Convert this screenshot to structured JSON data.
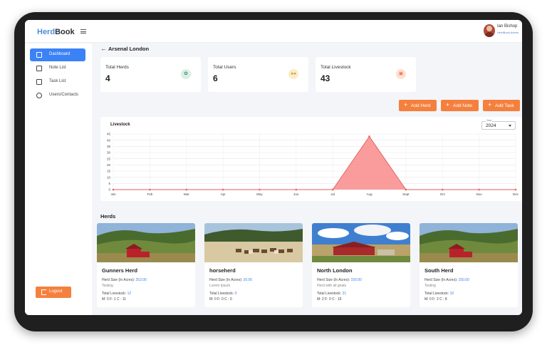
{
  "brand": {
    "part1": "Herd",
    "part2": "Book"
  },
  "user": {
    "name": "Ian Bishop",
    "role": "HerdBook Admin"
  },
  "sidebar": {
    "items": [
      {
        "label": "Dashboard",
        "icon": "grid-icon",
        "active": true
      },
      {
        "label": "Note List",
        "icon": "note-icon",
        "active": false
      },
      {
        "label": "Task List",
        "icon": "checkbox-icon",
        "active": false
      },
      {
        "label": "Users/Contacts",
        "icon": "users-icon",
        "active": false
      }
    ],
    "logout_label": "Logout"
  },
  "page": {
    "title": "Arsenal London"
  },
  "stats": [
    {
      "label": "Total Herds",
      "value": "4",
      "icon": "herd-icon",
      "color": "#d9efe6"
    },
    {
      "label": "Total Users",
      "value": "6",
      "icon": "users-icon",
      "color": "#fbeccb"
    },
    {
      "label": "Total Livestock",
      "value": "43",
      "icon": "livestock-icon",
      "color": "#fde0d4"
    }
  ],
  "actions": {
    "add_herd": "Add Herd",
    "add_note": "Add Note",
    "add_task": "Add Task"
  },
  "year_select": {
    "caption": "Year",
    "value": "2024"
  },
  "chart_data": {
    "type": "area",
    "title": "Livestock",
    "categories": [
      "Jan",
      "Feb",
      "Mar",
      "Apr",
      "May",
      "Jun",
      "Jul",
      "Aug",
      "Sept",
      "Oct",
      "Nov",
      "Dec"
    ],
    "values": [
      0,
      0,
      0,
      0,
      0,
      0,
      0,
      43,
      0,
      0,
      0,
      0
    ],
    "ylim": [
      0,
      45
    ],
    "yticks": [
      0,
      5,
      10,
      15,
      20,
      25,
      30,
      35,
      40,
      45
    ],
    "grid": true,
    "fill_color": "#f98b8b",
    "line_color": "#e45f5f"
  },
  "herds_title": "Herds",
  "herds": [
    {
      "name": "Gunners Herd",
      "size_label": "Herd Size (In Acres):",
      "size": "253.00",
      "desc": "Testing",
      "livestock_label": "Total Livestock:",
      "livestock": "12",
      "breakdown": "M: 0   F: 1   C : 11",
      "image": "barn-photo"
    },
    {
      "name": "horseherd",
      "size_label": "Herd Size (In Acres):",
      "size": "20.00",
      "desc": "Lorem Ipsum",
      "livestock_label": "Total Livestock:",
      "livestock": "0",
      "breakdown": "M: 0   F: 0   C : 0",
      "image": "horses-photo"
    },
    {
      "name": "North London",
      "size_label": "Herd Size (In Acres):",
      "size": "150.00",
      "desc": "Herd with all goats",
      "livestock_label": "Total Livestock:",
      "livestock": "21",
      "breakdown": "M: 2   F: 0   C : 19",
      "image": "ranch-photo"
    },
    {
      "name": "South Herd",
      "size_label": "Herd Size (In Acres):",
      "size": "150.00",
      "desc": "Testing",
      "livestock_label": "Total Livestock:",
      "livestock": "10",
      "breakdown": "M: 0   F: 2   C : 8",
      "image": "barn-photo"
    }
  ]
}
